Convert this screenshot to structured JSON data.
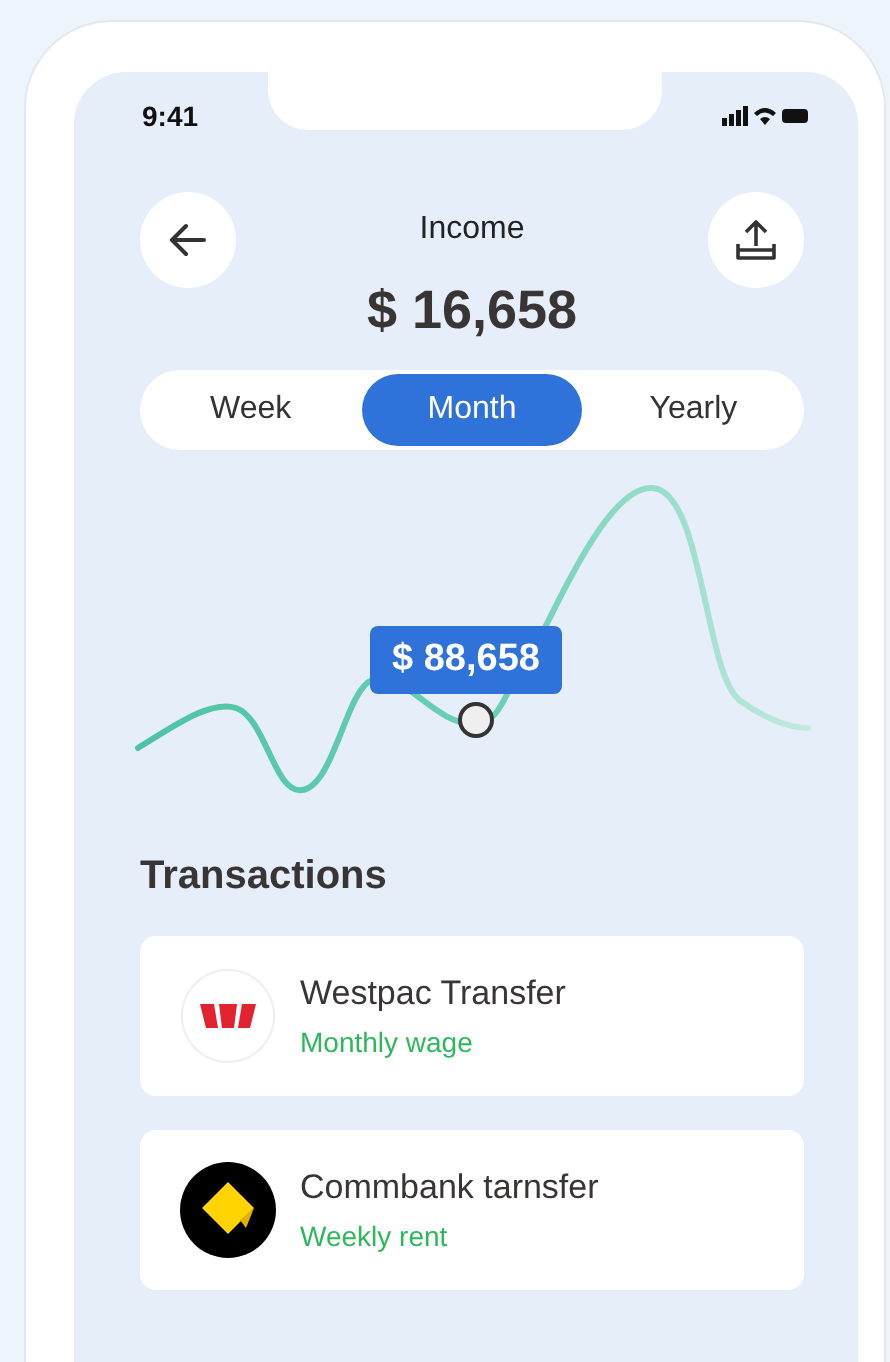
{
  "status_bar": {
    "time": "9:41"
  },
  "header": {
    "title": "Income",
    "amount": "$ 16,658"
  },
  "periods": [
    {
      "label": "Week",
      "selected": false
    },
    {
      "label": "Month",
      "selected": true
    },
    {
      "label": "Yearly",
      "selected": false
    }
  ],
  "chart": {
    "tooltip": "$ 88,658"
  },
  "transactions_title": "Transactions",
  "transactions": [
    {
      "kind": "stripes",
      "name": "Westpac Transfer",
      "note": "Monthly wage"
    },
    {
      "kind": "diamond",
      "name": "Commbank tarnsfer",
      "note": "Weekly rent"
    }
  ]
}
